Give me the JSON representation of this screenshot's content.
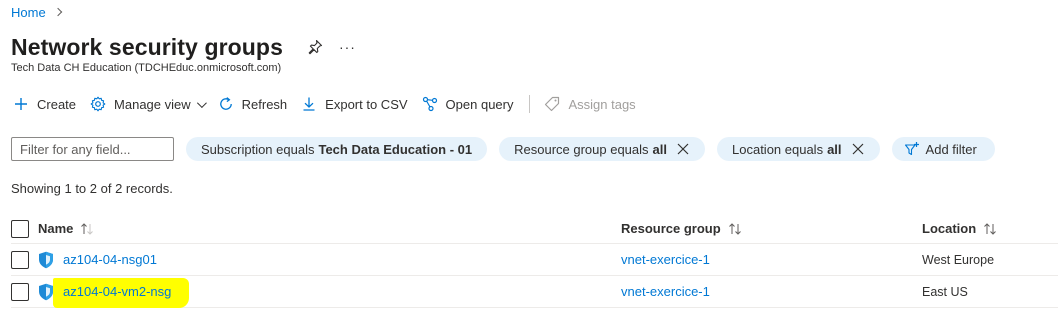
{
  "breadcrumb": {
    "home": "Home"
  },
  "page": {
    "title": "Network security groups",
    "more": "···",
    "subtitle": "Tech Data CH Education (TDCHEduc.onmicrosoft.com)"
  },
  "toolbar": {
    "create": "Create",
    "manage_view": "Manage view",
    "refresh": "Refresh",
    "export_csv": "Export to CSV",
    "open_query": "Open query",
    "assign_tags": "Assign tags"
  },
  "filters": {
    "placeholder": "Filter for any field...",
    "subscription_label": "Subscription equals",
    "subscription_value": "Tech Data Education - 01",
    "rg_label": "Resource group equals",
    "rg_value": "all",
    "location_label": "Location equals",
    "location_value": "all",
    "add_filter": "Add filter"
  },
  "records_text": "Showing 1 to 2 of 2 records.",
  "table": {
    "headers": {
      "name": "Name",
      "resource_group": "Resource group",
      "location": "Location"
    },
    "rows": [
      {
        "name": "az104-04-nsg01",
        "resource_group": "vnet-exercice-1",
        "location": "West Europe"
      },
      {
        "name": "az104-04-vm2-nsg",
        "resource_group": "vnet-exercice-1",
        "location": "East US"
      }
    ]
  },
  "colors": {
    "accent": "#0078d4",
    "pill_bg": "#e6f2fb",
    "highlight": "#ffff00"
  }
}
